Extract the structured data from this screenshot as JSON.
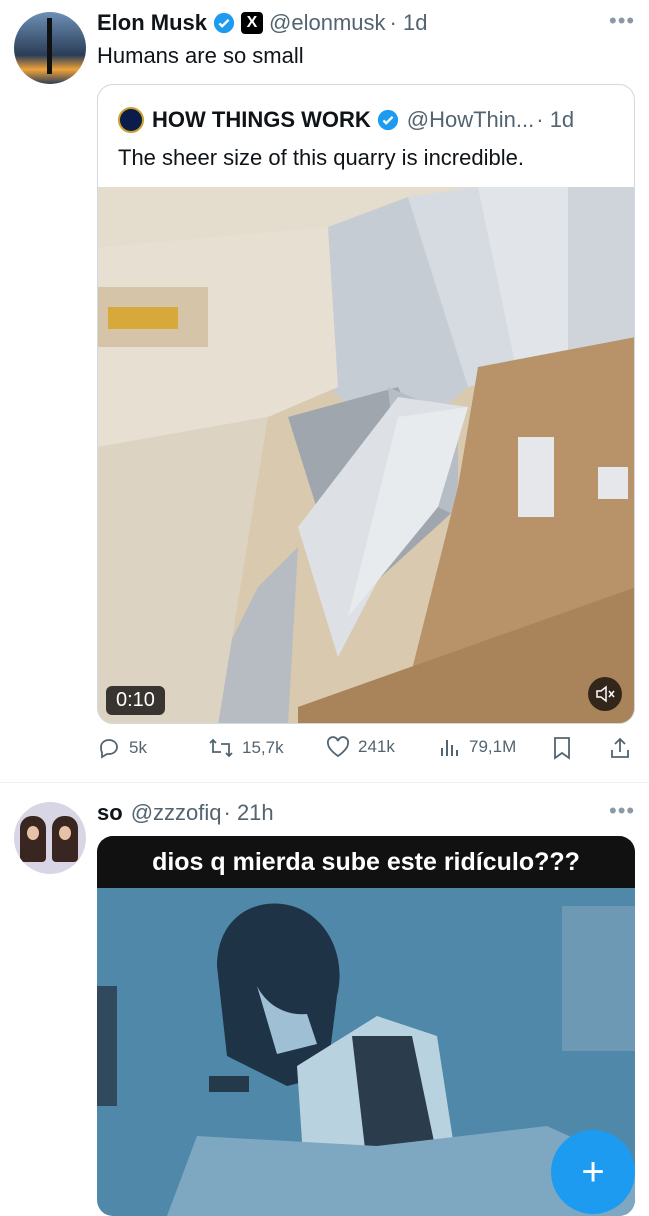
{
  "tweet1": {
    "name": "Elon Musk",
    "handle": "@elonmusk",
    "time": "· 1d",
    "text": "Humans are so small",
    "more_icon": "more-icon",
    "quote": {
      "name": "HOW THINGS WORK",
      "handle": "@HowThin...",
      "time": "· 1d",
      "text": "The sheer size of this quarry is incredible.",
      "video_time": "0:10"
    },
    "actions": {
      "replies": "5k",
      "reposts": "15,7k",
      "likes": "241k",
      "views": "79,1M"
    }
  },
  "tweet2": {
    "name": "so",
    "handle": "@zzzofiq",
    "time": "· 21h",
    "meme_caption": "dios q mierda sube este ridículo???"
  },
  "fab": {
    "label": "+"
  },
  "colors": {
    "accent": "#1d9bf0",
    "muted": "#536471",
    "border": "#cfd9de"
  }
}
